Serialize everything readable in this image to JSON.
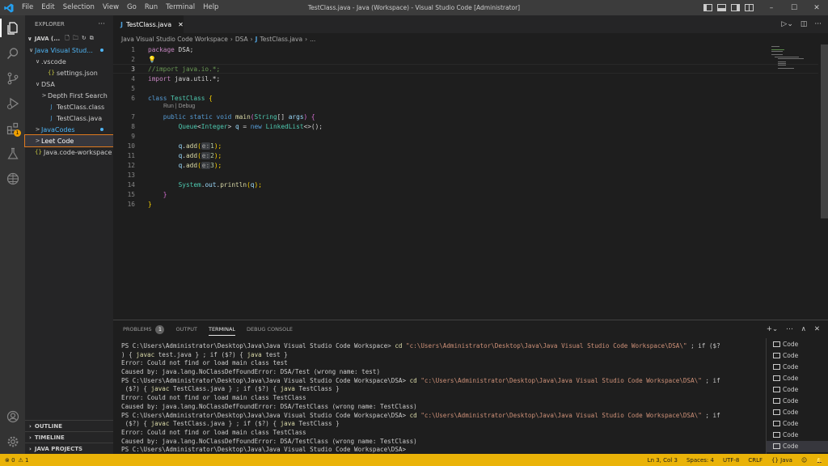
{
  "window": {
    "title": "TestClass.java - Java (Workspace) - Visual Studio Code [Administrator]",
    "menu": [
      "File",
      "Edit",
      "Selection",
      "View",
      "Go",
      "Run",
      "Terminal",
      "Help"
    ],
    "controls": {
      "minimize": "–",
      "maximize": "☐",
      "close": "✕"
    }
  },
  "activity_bar": {
    "icons": [
      "explorer-icon",
      "search-icon",
      "source-control-icon",
      "run-debug-icon",
      "extensions-icon",
      "testing-icon",
      "remote-icon"
    ],
    "extensions_badge": "1",
    "bottom_icons": [
      "account-icon",
      "settings-gear-icon"
    ]
  },
  "sidebar": {
    "title": "EXPLORER",
    "more": "···",
    "section": "JAVA (...",
    "tree": [
      {
        "label": "Java Visual Stud...",
        "level": 1,
        "twisty": "∨",
        "icon": "",
        "modified": true
      },
      {
        "label": ".vscode",
        "level": 2,
        "twisty": "∨",
        "icon": "",
        "modified": false
      },
      {
        "label": "settings.json",
        "level": 3,
        "twisty": "",
        "icon": "{}",
        "modified": false
      },
      {
        "label": "DSA",
        "level": 2,
        "twisty": "∨",
        "icon": "",
        "modified": false
      },
      {
        "label": "Depth First Search",
        "level": 3,
        "twisty": ">",
        "icon": "",
        "modified": false
      },
      {
        "label": "TestClass.class",
        "level": 3,
        "twisty": "",
        "icon": "J",
        "modified": false
      },
      {
        "label": "TestClass.java",
        "level": 3,
        "twisty": "",
        "icon": "J",
        "modified": false
      },
      {
        "label": "JavaCodes",
        "level": 2,
        "twisty": ">",
        "icon": "",
        "modified": true
      },
      {
        "label": "Leet Code",
        "level": 2,
        "twisty": ">",
        "icon": "",
        "modified": false,
        "selected": true
      },
      {
        "label": "Java.code-workspace",
        "level": 1,
        "twisty": "",
        "icon": "{}",
        "modified": false
      }
    ],
    "bottom_sections": [
      "OUTLINE",
      "TIMELINE",
      "JAVA PROJECTS"
    ]
  },
  "editor": {
    "tab_label": "TestClass.java",
    "tab_icon": "J",
    "breadcrumb": [
      "Java Visual Studio Code Workspace",
      "DSA",
      "TestClass.java",
      "..."
    ],
    "codelens": "Run | Debug",
    "current_line": 3,
    "lines": [
      "1",
      "2",
      "3",
      "4",
      "5",
      "6",
      "7",
      "8",
      "9",
      "10",
      "11",
      "12",
      "13",
      "14",
      "15",
      "16"
    ],
    "code": {
      "l1_kw": "package",
      "l1_rest": " DSA;",
      "l3": "//import java.io.*;",
      "l4_kw": "import",
      "l4_rest": " java.util.*;",
      "l6_kw": "class",
      "l6_name": " TestClass ",
      "l6_br": "{",
      "l7_mods": "public static void ",
      "l7_fn": "main",
      "l7_rest1": "(",
      "l7_ty": "String",
      "l7_rest2": "[] ",
      "l7_var": "args",
      "l7_rest3": ") {",
      "l8_ty": "Queue",
      "l8_lt": "<",
      "l8_ty2": "Integer",
      "l8_gt": "> ",
      "l8_var": "q",
      "l8_eq": " = ",
      "l8_new": "new ",
      "l8_ty3": "LinkedList",
      "l8_end": "<>();",
      "add_var": "q",
      "add_dot": ".",
      "add_fn": "add",
      "add_open": "(",
      "hint": "e:",
      "add_close": ");",
      "add_vals": [
        "1",
        "2",
        "3"
      ],
      "l14_ty": "System",
      "l14_dot1": ".",
      "l14_var": "out",
      "l14_dot2": ".",
      "l14_fn": "println",
      "l14_open": "(",
      "l14_arg": "q",
      "l14_close": ");",
      "l15": "}",
      "l16": "}"
    }
  },
  "panel": {
    "tabs": [
      "PROBLEMS",
      "OUTPUT",
      "TERMINAL",
      "DEBUG CONSOLE"
    ],
    "problems_count": "1",
    "active_tab": "TERMINAL",
    "actions": [
      "+⌄",
      "⋯",
      "∧",
      "✕"
    ],
    "terminal_lines": [
      {
        "type": "cmd",
        "prompt": "PS C:\\Users\\Administrator\\Desktop\\Java\\Java Visual Studio Code Workspace> ",
        "cmd": "cd",
        "str": " \"c:\\Users\\Administrator\\Desktop\\Java\\Java Visual Studio Code Workspace\\DSA\\\"",
        "rest": " ; if ($?"
      },
      {
        "type": "cont",
        "text1": ") { ",
        "kw1": "javac",
        "text2": " test.java } ; if ($?) { ",
        "kw2": "java",
        "text3": " test }"
      },
      {
        "type": "plain",
        "text": "Error: Could not find or load main class test"
      },
      {
        "type": "plain",
        "text": "Caused by: java.lang.NoClassDefFoundError: DSA/Test (wrong name: test)"
      },
      {
        "type": "cmd",
        "prompt": "PS C:\\Users\\Administrator\\Desktop\\Java\\Java Visual Studio Code Workspace\\DSA> ",
        "cmd": "cd",
        "str": " \"c:\\Users\\Administrator\\Desktop\\Java\\Java Visual Studio Code Workspace\\DSA\\\"",
        "rest": " ; if"
      },
      {
        "type": "cont",
        "text1": " ($?) { ",
        "kw1": "javac",
        "text2": " TestClass.java } ; if ($?) { ",
        "kw2": "java",
        "text3": " TestClass }"
      },
      {
        "type": "plain",
        "text": "Error: Could not find or load main class TestClass"
      },
      {
        "type": "plain",
        "text": "Caused by: java.lang.NoClassDefFoundError: DSA/TestClass (wrong name: TestClass)"
      },
      {
        "type": "cmd",
        "prompt": "PS C:\\Users\\Administrator\\Desktop\\Java\\Java Visual Studio Code Workspace\\DSA> ",
        "cmd": "cd",
        "str": " \"c:\\Users\\Administrator\\Desktop\\Java\\Java Visual Studio Code Workspace\\DSA\\\"",
        "rest": " ; if"
      },
      {
        "type": "cont",
        "text1": " ($?) { ",
        "kw1": "javac",
        "text2": " TestClass.java } ; if ($?) { ",
        "kw2": "java",
        "text3": " TestClass }"
      },
      {
        "type": "plain",
        "text": "Error: Could not find or load main class TestClass"
      },
      {
        "type": "plain",
        "text": "Caused by: java.lang.NoClassDefFoundError: DSA/TestClass (wrong name: TestClass)"
      },
      {
        "type": "plain",
        "text": "PS C:\\Users\\Administrator\\Desktop\\Java\\Java Visual Studio Code Workspace\\DSA> "
      }
    ],
    "terminal_instances": [
      "Code",
      "Code",
      "Code",
      "Code",
      "Code",
      "Code",
      "Code",
      "Code",
      "Code",
      "Code"
    ]
  },
  "statusbar": {
    "errors": "⊗ 0",
    "warnings": "⚠ 1",
    "position": "Ln 3, Col 3",
    "spaces": "Spaces: 4",
    "encoding": "UTF-8",
    "eol": "CRLF",
    "language": "{} Java",
    "color": "#eab308"
  }
}
